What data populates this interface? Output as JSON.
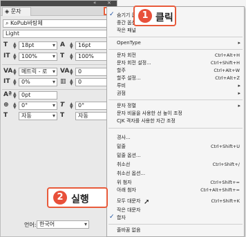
{
  "panel": {
    "tab_label": "문자",
    "menu_button": "≡",
    "font_family": "KoPub바탕체",
    "font_style": "Light",
    "font_size": "18pt",
    "leading": "16pt",
    "vertical_scale": "100%",
    "horizontal_scale": "100%",
    "kerning": "메트릭 - 로",
    "tracking": "0",
    "tsume": "0%",
    "aki": "0",
    "baseline_shift": "0pt",
    "skew": "0°",
    "rotation": "0°",
    "char_align_1": "자동",
    "char_align_2": "자동",
    "language_label": "언어:",
    "language": "한국어"
  },
  "menu": {
    "items": [
      {
        "label": "숨기기 옵션",
        "shortcut": "",
        "arrow": false
      },
      {
        "label": "중간 옵션",
        "shortcut": "",
        "arrow": false
      },
      {
        "label": "작은 패널",
        "shortcut": "",
        "arrow": false
      },
      {
        "label": "OpenType",
        "shortcut": "",
        "arrow": true
      },
      {
        "label": "문자 회전",
        "shortcut": "Ctrl+Alt+H",
        "arrow": false
      },
      {
        "label": "문자 회전 설정...",
        "shortcut": "Ctrl+Shift+H",
        "arrow": false
      },
      {
        "label": "할주",
        "shortcut": "Ctrl+Alt+W",
        "arrow": false
      },
      {
        "label": "할주 설정...",
        "shortcut": "Ctrl+Alt+Z",
        "arrow": false
      },
      {
        "label": "루비",
        "shortcut": "",
        "arrow": true
      },
      {
        "label": "권점",
        "shortcut": "",
        "arrow": true
      },
      {
        "label": "문자 정렬",
        "shortcut": "",
        "arrow": true
      },
      {
        "label": "문자 비율을 사용한 선 높이 조정",
        "shortcut": "",
        "arrow": false
      },
      {
        "label": "CJK 격자를 사용한 자간 조정",
        "shortcut": "",
        "arrow": false
      },
      {
        "label": "경사...",
        "shortcut": "",
        "arrow": false
      },
      {
        "label": "밑줄",
        "shortcut": "Ctrl+Shift+U",
        "arrow": false
      },
      {
        "label": "밑줄 옵션...",
        "shortcut": "",
        "arrow": false
      },
      {
        "label": "취소선",
        "shortcut": "Ctrl+Shift+/",
        "arrow": false
      },
      {
        "label": "취소선 옵션...",
        "shortcut": "",
        "arrow": false
      },
      {
        "label": "위 첨자",
        "shortcut": "Ctrl+Shift+=",
        "arrow": false
      },
      {
        "label": "아래 첨자",
        "shortcut": "Ctrl+Alt+Shift+=",
        "arrow": false
      },
      {
        "label": "모두 대문자",
        "shortcut": "Ctrl+Shift+K",
        "arrow": false
      },
      {
        "label": "작은 대문자",
        "shortcut": "",
        "arrow": false
      },
      {
        "label": "합자",
        "shortcut": "",
        "arrow": false
      },
      {
        "label": "줄바꿈 없음",
        "shortcut": "",
        "arrow": false
      }
    ]
  },
  "callouts": {
    "step1_number": "1",
    "step1_label": "클릭",
    "step2_number": "2",
    "step2_label": "실행"
  },
  "icons": {
    "check": "✓"
  }
}
